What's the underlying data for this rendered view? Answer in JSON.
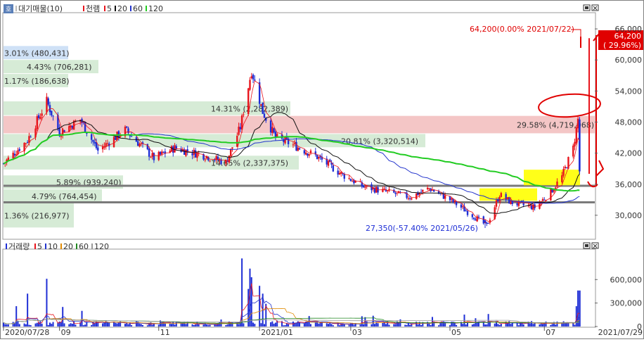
{
  "colors": {
    "up": "#e8141c",
    "down": "#1f2fd6",
    "ma5": "#e8141c",
    "ma20": "#111111",
    "ma60": "#2233cc",
    "ma120": "#22cc22",
    "vol10": "#2233cc",
    "vol20": "#e08a00",
    "vol60": "#228822",
    "vol120": "#999999",
    "profile_green": "#cfe8cf",
    "profile_pink": "#f2bcbc",
    "profile_blue": "#c7dcf5",
    "highlight": "#ffff00",
    "annotation": "#e00000"
  },
  "toolbar": {
    "badge": "호",
    "price_legend": [
      {
        "label": "대기매물(10)",
        "color": "#bbbbbb"
      },
      {
        "label": "천램",
        "color": "#e8141c"
      },
      {
        "label": "5",
        "color": "#e8141c"
      },
      {
        "label": "20",
        "color": "#111111"
      },
      {
        "label": "60",
        "color": "#2233cc"
      },
      {
        "label": "120",
        "color": "#22cc22"
      }
    ],
    "volume_legend": [
      {
        "label": "거래량",
        "color": "#1f2fd6"
      },
      {
        "label": "5",
        "color": "#e8141c"
      },
      {
        "label": "10",
        "color": "#2233cc"
      },
      {
        "label": "20",
        "color": "#e08a00"
      },
      {
        "label": "60",
        "color": "#228822"
      },
      {
        "label": "120",
        "color": "#999999"
      }
    ]
  },
  "chart_data": [
    {
      "type": "candlestick",
      "title": "",
      "y_axis_side": "right",
      "ylim": [
        25500,
        69000
      ],
      "y_ticks": [
        "66,000",
        "60,000",
        "54,000",
        "48,000",
        "42,000",
        "36,000",
        "30,000"
      ],
      "y_tick_values": [
        66000,
        60000,
        54000,
        48000,
        42000,
        36000,
        30000
      ],
      "x_range": [
        "2020-07-28",
        "2021-07-29"
      ],
      "anchors": [
        {
          "date": "2020-07-28",
          "close": 40000
        },
        {
          "date": "2020-08-12",
          "close": 44500
        },
        {
          "date": "2020-08-24",
          "close": 52000
        },
        {
          "date": "2020-09-01",
          "close": 46000
        },
        {
          "date": "2020-09-14",
          "close": 48500
        },
        {
          "date": "2020-09-25",
          "close": 42500
        },
        {
          "date": "2020-10-12",
          "close": 46500
        },
        {
          "date": "2020-10-30",
          "close": 41000
        },
        {
          "date": "2020-11-12",
          "close": 43000
        },
        {
          "date": "2020-12-01",
          "close": 41500
        },
        {
          "date": "2020-12-14",
          "close": 40200
        },
        {
          "date": "2020-12-23",
          "close": 47000
        },
        {
          "date": "2020-12-30",
          "close": 58000
        },
        {
          "date": "2021-01-06",
          "close": 50000
        },
        {
          "date": "2021-01-14",
          "close": 45000
        },
        {
          "date": "2021-01-22",
          "close": 44000
        },
        {
          "date": "2021-02-08",
          "close": 41500
        },
        {
          "date": "2021-02-24",
          "close": 38000
        },
        {
          "date": "2021-03-10",
          "close": 35500
        },
        {
          "date": "2021-03-25",
          "close": 34500
        },
        {
          "date": "2021-04-08",
          "close": 33500
        },
        {
          "date": "2021-04-20",
          "close": 35200
        },
        {
          "date": "2021-05-03",
          "close": 33000
        },
        {
          "date": "2021-05-17",
          "close": 30000
        },
        {
          "date": "2021-05-26",
          "close": 28000
        },
        {
          "date": "2021-06-03",
          "close": 34000
        },
        {
          "date": "2021-06-10",
          "close": 32500
        },
        {
          "date": "2021-06-25",
          "close": 31500
        },
        {
          "date": "2021-07-05",
          "close": 34500
        },
        {
          "date": "2021-07-12",
          "close": 37500
        },
        {
          "date": "2021-07-19",
          "close": 43000
        },
        {
          "date": "2021-07-22",
          "close": 48500
        },
        {
          "date": "2021-07-23",
          "close": 38500
        }
      ],
      "volume_profile": [
        {
          "label": "3.01% (480,431)",
          "price_low": 60000,
          "price_high": 62700,
          "fill": "blue"
        },
        {
          "label": "4.43% (706,281)",
          "price_low": 57300,
          "price_high": 60000,
          "fill": "green"
        },
        {
          "label": "1.17% (186,638)",
          "price_low": 54600,
          "price_high": 57300,
          "fill": "green"
        },
        {
          "label": "14.31% (2,282,389)",
          "price_low": 49200,
          "price_high": 52000,
          "fill": "green"
        },
        {
          "label": "29.58% (4,719,068)",
          "price_low": 45700,
          "price_high": 49200,
          "fill": "pink"
        },
        {
          "label": "20.81% (3,320,514)",
          "price_low": 43000,
          "price_high": 45700,
          "fill": "green"
        },
        {
          "label": "14.65% (2,337,375)",
          "price_low": 38700,
          "price_high": 41500,
          "fill": "green"
        },
        {
          "label": "5.89% (939,240)",
          "price_low": 35000,
          "price_high": 37700,
          "fill": "green"
        },
        {
          "label": "4.79% (764,454)",
          "price_low": 32300,
          "price_high": 35000,
          "fill": "green"
        },
        {
          "label": "1.36% (216,977)",
          "price_low": 27500,
          "price_high": 32300,
          "fill": "green"
        }
      ],
      "support_lines": [
        35700,
        32500
      ],
      "max_marker": {
        "label": "64,200(0.00% 2021/07/22)",
        "value": 64200
      },
      "min_marker": {
        "label": "27,350(-57.40% 2021/05/26)",
        "value": 27350
      },
      "last_price": {
        "line1": "64,200",
        "line2": "( 29.96%)"
      }
    },
    {
      "type": "bar",
      "title": "",
      "y_axis_side": "right",
      "ylim": [
        0,
        980000
      ],
      "y_ticks": [
        "600,000",
        "300,000",
        "0"
      ],
      "y_tick_values": [
        600000,
        300000,
        0
      ],
      "x_ticks": [
        "2020/07/28",
        "09",
        "11",
        "2021/01",
        "03",
        "05",
        "07"
      ],
      "x_end_label": "2021/07/29",
      "spikes": [
        {
          "date": "2020-08-24",
          "volume": 610000
        },
        {
          "date": "2020-08-12",
          "volume": 420000
        },
        {
          "date": "2020-08-05",
          "volume": 260000
        },
        {
          "date": "2020-09-03",
          "volume": 250000
        },
        {
          "date": "2020-09-15",
          "volume": 200000
        },
        {
          "date": "2020-12-24",
          "volume": 870000
        },
        {
          "date": "2020-12-29",
          "volume": 740000
        },
        {
          "date": "2020-12-30",
          "volume": 630000
        },
        {
          "date": "2020-12-28",
          "volume": 480000
        },
        {
          "date": "2021-01-04",
          "volume": 520000
        },
        {
          "date": "2021-01-06",
          "volume": 420000
        },
        {
          "date": "2021-01-08",
          "volume": 290000
        },
        {
          "date": "2021-05-27",
          "volume": 160000
        },
        {
          "date": "2021-07-21",
          "volume": 260000
        },
        {
          "date": "2021-07-22",
          "volume": 460000
        }
      ]
    }
  ]
}
